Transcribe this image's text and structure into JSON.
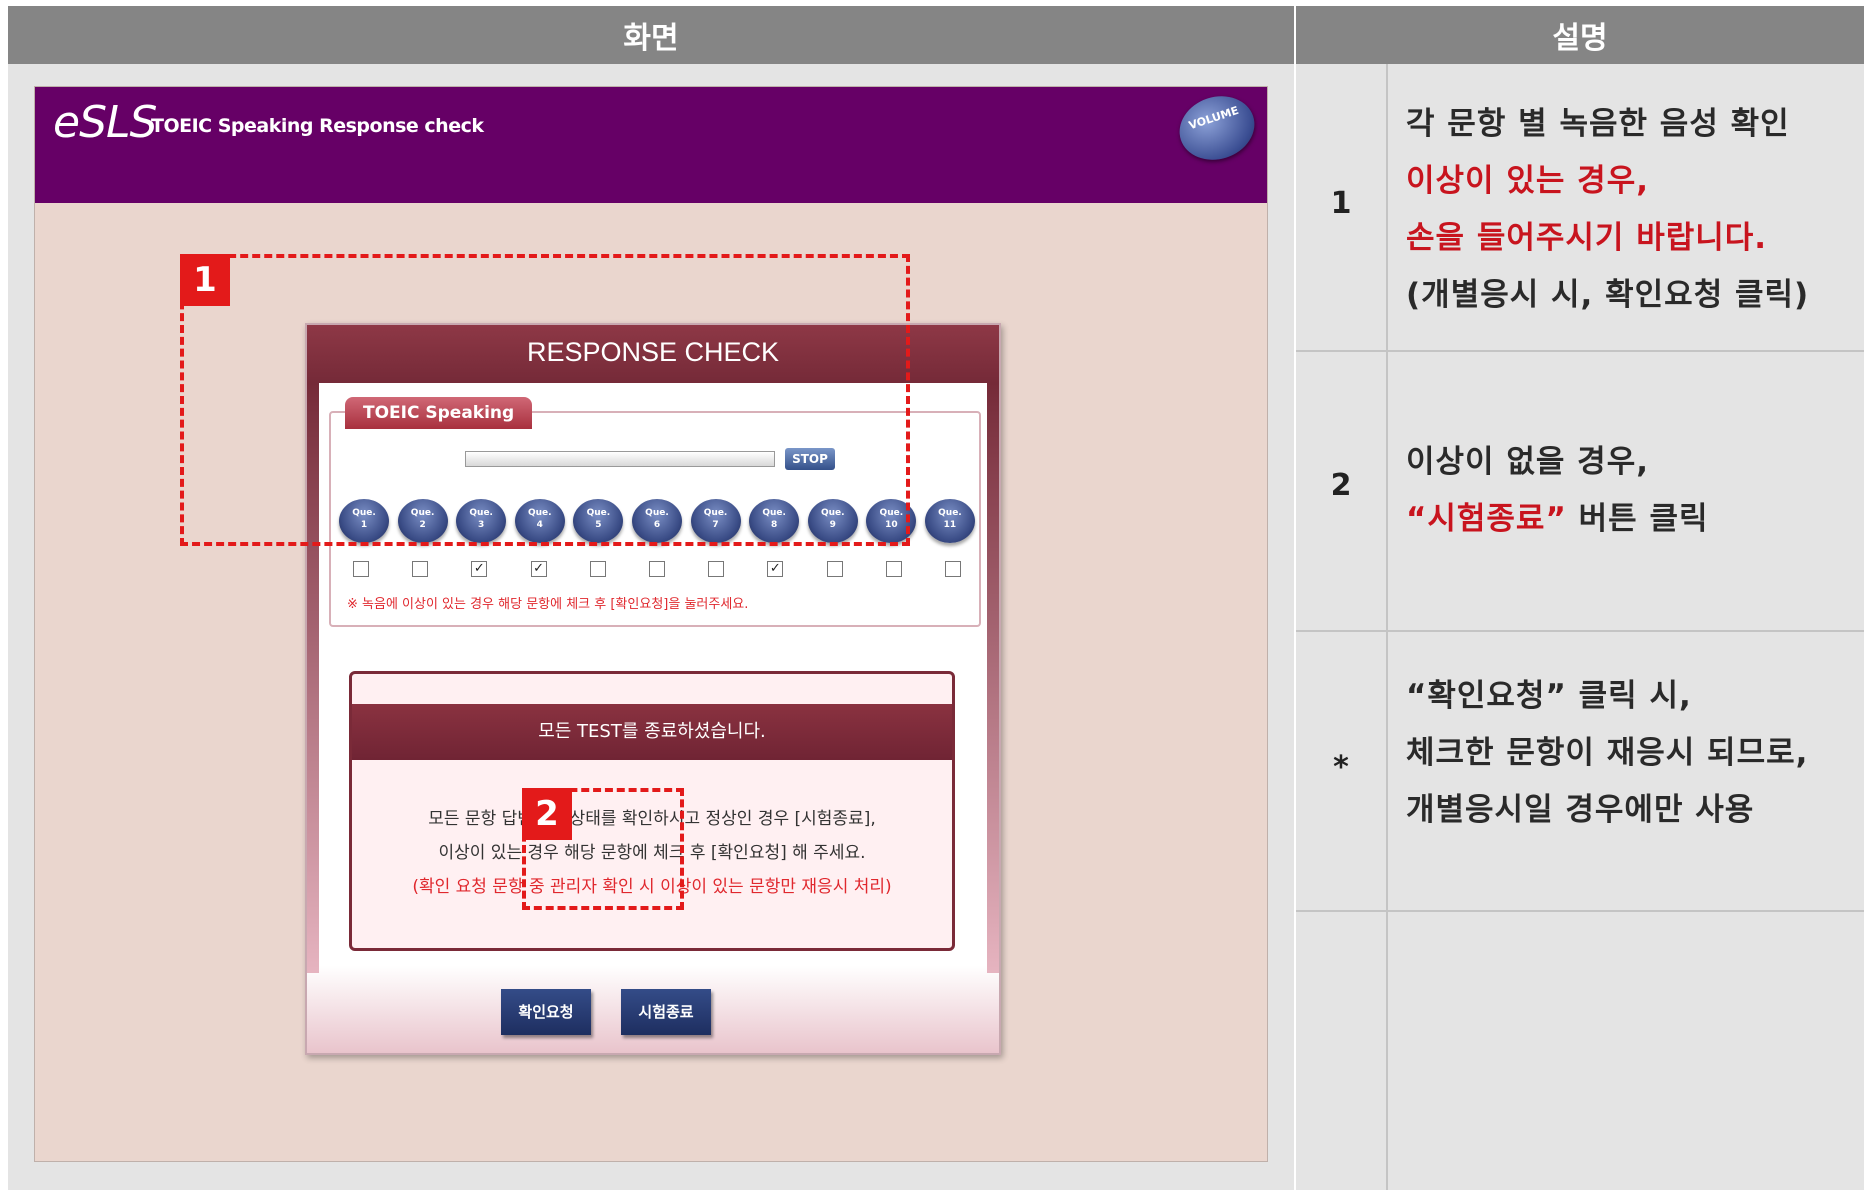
{
  "table": {
    "header_screen": "화면",
    "header_desc": "설명"
  },
  "rows": [
    {
      "num": "1",
      "lines": [
        "각 문항 별 녹음한 음성 확인",
        "이상이 있는 경우,",
        "손을 들어주시기 바랍니다.",
        "(개별응시 시, 확인요청 클릭)"
      ],
      "red_lines": [
        1,
        2
      ]
    },
    {
      "num": "2",
      "line1": "이상이 없을 경우,",
      "line2_red": "“시험종료”",
      "line2_rest": " 버튼 클릭"
    },
    {
      "num": "*",
      "lines": [
        "“확인요청” 클릭 시,",
        "체크한 문항이 재응시 되므로,",
        "개별응시일 경우에만 사용"
      ]
    }
  ],
  "app": {
    "logo": "eSLS",
    "title": "TOEIC Speaking Response check",
    "volume_label": "VOLUME",
    "dialog_title": "RESPONSE CHECK",
    "group_label": "TOEIC Speaking",
    "stop_label": "STOP",
    "question_prefix": "Que.",
    "questions": [
      "1",
      "2",
      "3",
      "4",
      "5",
      "6",
      "7",
      "8",
      "9",
      "10",
      "11"
    ],
    "checked": [
      false,
      false,
      true,
      true,
      false,
      false,
      false,
      true,
      false,
      false,
      false
    ],
    "small_notice": "※ 녹음에 이상이 있는 경우 해당 문항에 체크 후 [확인요청]을 눌러주세요.",
    "msg_title": "모든 TEST를 종료하셨습니다.",
    "msg_line1": "모든 문항 답변 녹음상태를 확인하시고 정상인 경우 [시험종료],",
    "msg_line2": "이상이 있는 경우 해당 문항에 체크 후 [확인요청] 해 주세요.",
    "msg_line3": "(확인 요청 문항 중 관리자 확인 시 이상이 있는 문항만 재응시 처리)",
    "confirm_label": "확인요청",
    "end_label": "시험종료"
  },
  "annotations": {
    "badge1": "1",
    "badge2": "2"
  },
  "colors": {
    "header_gray": "#858585",
    "app_purple": "#660066",
    "dialog_maroon": "#752a38",
    "annotation_red": "#e31a1a",
    "text_red": "#c8141e"
  }
}
